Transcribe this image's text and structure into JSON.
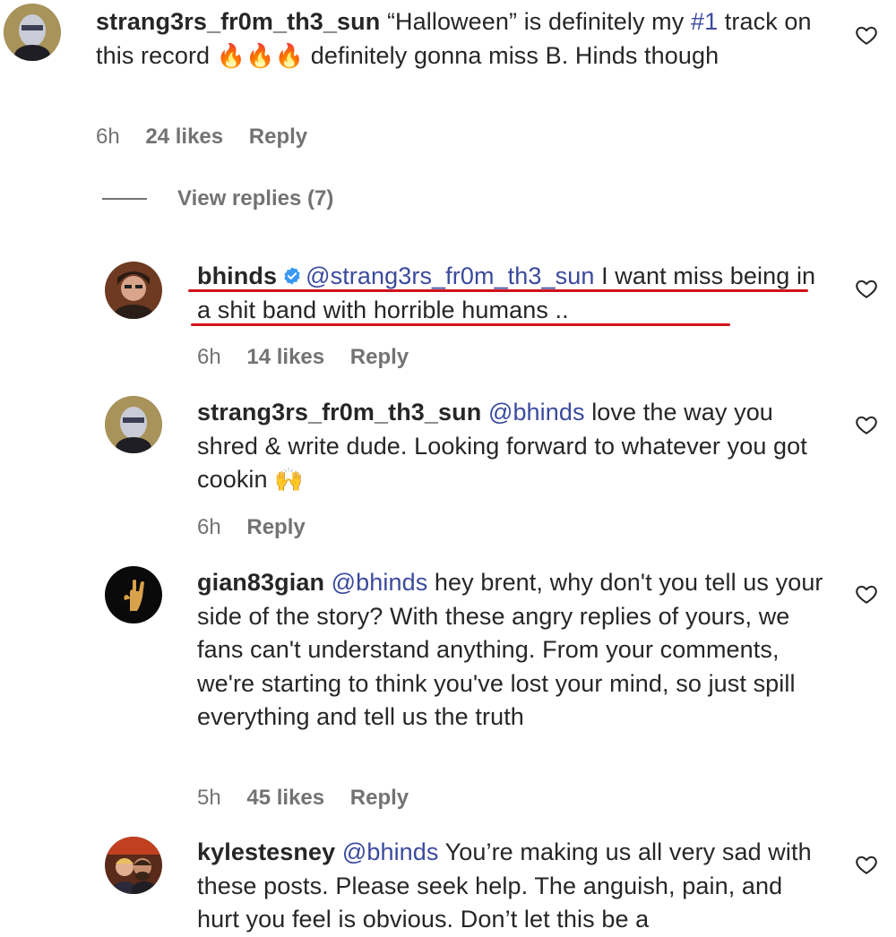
{
  "comments": [
    {
      "username": "strang3rs_fr0m_th3_sun",
      "text_before": "“Halloween” is definitely my ",
      "hashtag": "#1",
      "text_after": " track on this record ",
      "emoji": "🔥🔥🔥",
      "text_end": " definitely gonna miss B. Hinds though",
      "time": "6h",
      "likes": "24 likes",
      "reply": "Reply"
    },
    {
      "username": "bhinds",
      "verified": true,
      "mention": "@strang3rs_fr0m_th3_sun",
      "text": " I want miss being in a shit band with horrible humans ..",
      "time": "6h",
      "likes": "14 likes",
      "reply": "Reply"
    },
    {
      "username": "strang3rs_fr0m_th3_sun",
      "mention": "@bhinds",
      "text": " love the way you shred & write dude. Looking forward to whatever you got cookin ",
      "emoji": "🙌",
      "time": "6h",
      "reply": "Reply"
    },
    {
      "username": "gian83gian",
      "mention": "@bhinds",
      "text": " hey brent, why don't you tell us your side of the story? With these angry replies of yours, we fans can't understand anything. From your comments, we're starting to think you've lost your mind, so just spill everything and tell us the truth",
      "time": "5h",
      "likes": "45 likes",
      "reply": "Reply"
    },
    {
      "username": "kylestesney",
      "mention": "@bhinds",
      "text": " You’re making us all very sad with these posts. Please seek help. The anguish, pain, and hurt you feel is obvious. Don’t let this be a"
    }
  ],
  "view_replies": "View replies (7)",
  "icons": {
    "like": "heart-outline-icon",
    "verified": "verified-badge-icon"
  },
  "colors": {
    "mention": "#3b4a9e",
    "meta": "#737373",
    "underline": "#d0121b",
    "verified": "#3897f0"
  }
}
